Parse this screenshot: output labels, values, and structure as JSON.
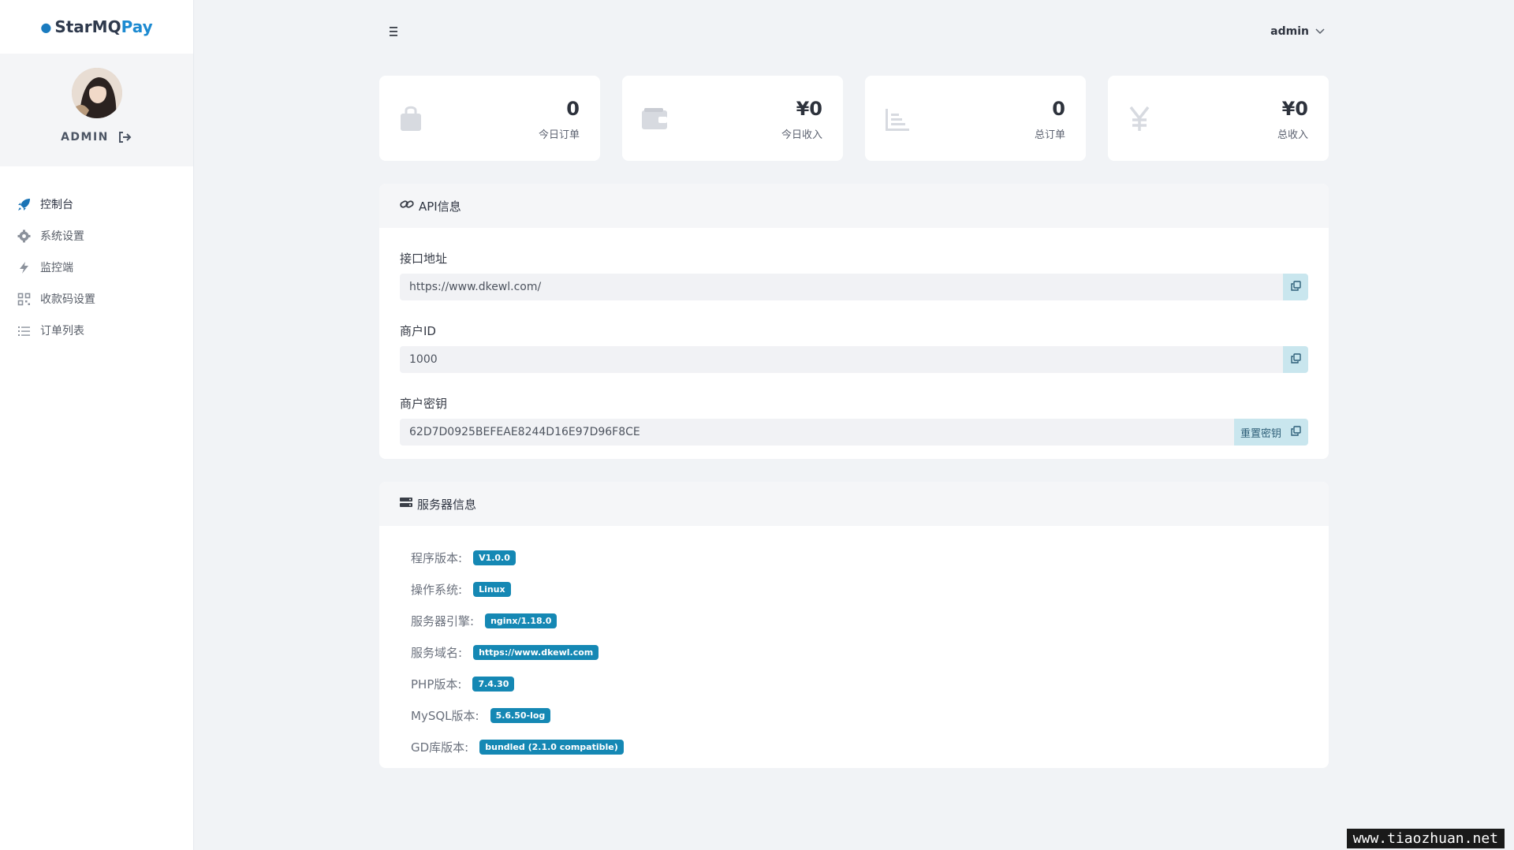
{
  "brand": {
    "part1": "StarMQ",
    "part2": "Pay"
  },
  "profile": {
    "name": "ADMIN"
  },
  "menu": [
    {
      "label": "控制台",
      "icon": "rocket-icon"
    },
    {
      "label": "系统设置",
      "icon": "gear-icon"
    },
    {
      "label": "监控端",
      "icon": "lightning-icon"
    },
    {
      "label": "收款码设置",
      "icon": "qrcode-icon"
    },
    {
      "label": "订单列表",
      "icon": "list-icon"
    }
  ],
  "header": {
    "user": "admin"
  },
  "stats": [
    {
      "value": "0",
      "label": "今日订单",
      "icon": "shopping-bag-icon"
    },
    {
      "value": "¥0",
      "label": "今日收入",
      "icon": "wallet-icon"
    },
    {
      "value": "0",
      "label": "总订单",
      "icon": "bar-chart-icon"
    },
    {
      "value": "¥0",
      "label": "总收入",
      "icon": "yen-icon"
    }
  ],
  "api": {
    "title": "API信息",
    "endpoint_label": "接口地址",
    "endpoint_value": "https://www.dkewl.com/",
    "merchant_id_label": "商户ID",
    "merchant_id_value": "1000",
    "merchant_key_label": "商户密钥",
    "merchant_key_value": "62D7D0925BEFEAE8244D16E97D96F8CE",
    "reset_key_label": "重置密钥"
  },
  "server": {
    "title": "服务器信息",
    "rows": [
      {
        "label": "程序版本:",
        "value": "V1.0.0"
      },
      {
        "label": "操作系统:",
        "value": "Linux"
      },
      {
        "label": "服务器引擎:",
        "value": "nginx/1.18.0"
      },
      {
        "label": "服务域名:",
        "value": "https://www.dkewl.com"
      },
      {
        "label": "PHP版本:",
        "value": "7.4.30"
      },
      {
        "label": "MySQL版本:",
        "value": "5.6.50-log"
      },
      {
        "label": "GD库版本:",
        "value": "bundled (2.1.0 compatible)"
      }
    ]
  },
  "watermark": "www.tiaozhuan.net",
  "colors": {
    "accent": "#1c8ad1",
    "badge": "#1588b4",
    "copy_button": "#c9e6ee"
  }
}
